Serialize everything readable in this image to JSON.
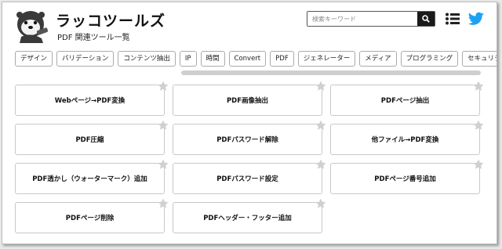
{
  "header": {
    "title": "ラッコツールズ",
    "subtitle": "PDF 関連ツール一覧",
    "search_placeholder": "検索キーワード"
  },
  "icons": {
    "logo": "sea-otter-logo",
    "search": "search-icon",
    "menu": "list-icon",
    "twitter": "twitter-icon",
    "favorite": "star-icon"
  },
  "colors": {
    "twitter": "#1da1f2",
    "star": "#d0d0d0",
    "search_button": "#1a1a1a"
  },
  "tags": [
    "デザイン",
    "バリデーション",
    "コンテンツ抽出",
    "IP",
    "時間",
    "Convert",
    "PDF",
    "ジェネレーター",
    "メディア",
    "プログラミング",
    "セキュリティ"
  ],
  "tools": [
    "Webページ→PDF変換",
    "PDF画像抽出",
    "PDFページ抽出",
    "PDF圧縮",
    "PDFパスワード解除",
    "他ファイル→PDF変換",
    "PDF透かし（ウォーターマーク）追加",
    "PDFパスワード設定",
    "PDFページ番号追加",
    "PDFページ削除",
    "PDFヘッダー・フッター追加"
  ]
}
